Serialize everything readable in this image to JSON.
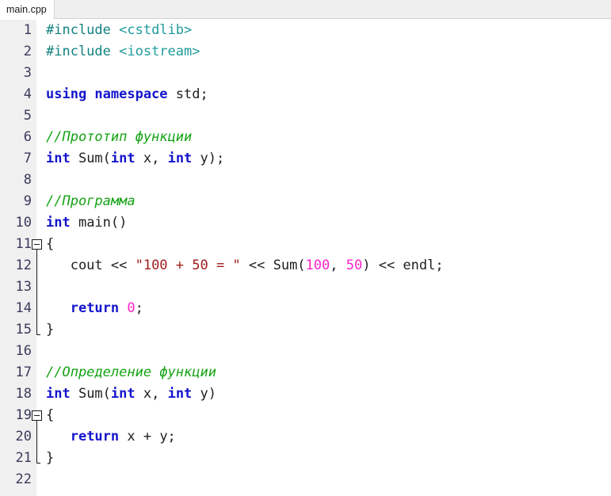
{
  "window": {
    "title": "main.cpp",
    "gutter_bg": "#f0f0f0",
    "editor_bg": "#ffffff",
    "tabbar_bg": "#efefef"
  },
  "tabs": [
    {
      "label": "main.cpp",
      "active": true
    }
  ],
  "colors": {
    "preprocessor": "#12817f",
    "header": "#1f9c9c",
    "keyword": "#1414cc",
    "comment": "#13a313",
    "string": "#9e1c1c",
    "number": "#ff22cc",
    "plain": "#202020",
    "linenumber": "#3a3a5c"
  },
  "editor": {
    "language": "C++",
    "total_lines": 22,
    "lines": [
      {
        "n": "1",
        "fold": "none",
        "tokens": [
          {
            "t": "pre",
            "v": "#include "
          },
          {
            "t": "hdr",
            "v": "<cstdlib>"
          }
        ]
      },
      {
        "n": "2",
        "fold": "none",
        "tokens": [
          {
            "t": "pre",
            "v": "#include "
          },
          {
            "t": "hdr",
            "v": "<iostream>"
          }
        ]
      },
      {
        "n": "3",
        "fold": "none",
        "tokens": []
      },
      {
        "n": "4",
        "fold": "none",
        "tokens": [
          {
            "t": "kw",
            "v": "using namespace"
          },
          {
            "t": "plain",
            "v": " std;"
          }
        ]
      },
      {
        "n": "5",
        "fold": "none",
        "tokens": []
      },
      {
        "n": "6",
        "fold": "none",
        "tokens": [
          {
            "t": "cmt",
            "v": "//Прототип функции"
          }
        ]
      },
      {
        "n": "7",
        "fold": "none",
        "tokens": [
          {
            "t": "kw",
            "v": "int"
          },
          {
            "t": "plain",
            "v": " Sum("
          },
          {
            "t": "kw",
            "v": "int"
          },
          {
            "t": "plain",
            "v": " x, "
          },
          {
            "t": "kw",
            "v": "int"
          },
          {
            "t": "plain",
            "v": " y);"
          }
        ]
      },
      {
        "n": "8",
        "fold": "none",
        "tokens": []
      },
      {
        "n": "9",
        "fold": "none",
        "tokens": [
          {
            "t": "cmt",
            "v": "//Программа"
          }
        ]
      },
      {
        "n": "10",
        "fold": "none",
        "tokens": [
          {
            "t": "kw",
            "v": "int"
          },
          {
            "t": "plain",
            "v": " main()"
          }
        ]
      },
      {
        "n": "11",
        "fold": "box",
        "tokens": [
          {
            "t": "brace",
            "v": "{"
          }
        ]
      },
      {
        "n": "12",
        "fold": "line",
        "tokens": [
          {
            "t": "plain",
            "v": "   cout << "
          },
          {
            "t": "str",
            "v": "\"100 + 50 = \""
          },
          {
            "t": "plain",
            "v": " << Sum("
          },
          {
            "t": "num",
            "v": "100"
          },
          {
            "t": "plain",
            "v": ", "
          },
          {
            "t": "num",
            "v": "50"
          },
          {
            "t": "plain",
            "v": ") << endl;"
          }
        ]
      },
      {
        "n": "13",
        "fold": "line",
        "tokens": []
      },
      {
        "n": "14",
        "fold": "line",
        "tokens": [
          {
            "t": "plain",
            "v": "   "
          },
          {
            "t": "kw",
            "v": "return"
          },
          {
            "t": "plain",
            "v": " "
          },
          {
            "t": "num",
            "v": "0"
          },
          {
            "t": "plain",
            "v": ";"
          }
        ]
      },
      {
        "n": "15",
        "fold": "end",
        "tokens": [
          {
            "t": "brace",
            "v": "}"
          }
        ]
      },
      {
        "n": "16",
        "fold": "none",
        "tokens": []
      },
      {
        "n": "17",
        "fold": "none",
        "tokens": [
          {
            "t": "cmt",
            "v": "//Определение функции"
          }
        ]
      },
      {
        "n": "18",
        "fold": "none",
        "tokens": [
          {
            "t": "kw",
            "v": "int"
          },
          {
            "t": "plain",
            "v": " Sum("
          },
          {
            "t": "kw",
            "v": "int"
          },
          {
            "t": "plain",
            "v": " x, "
          },
          {
            "t": "kw",
            "v": "int"
          },
          {
            "t": "plain",
            "v": " y)"
          }
        ]
      },
      {
        "n": "19",
        "fold": "box",
        "tokens": [
          {
            "t": "brace",
            "v": "{"
          }
        ]
      },
      {
        "n": "20",
        "fold": "line",
        "tokens": [
          {
            "t": "plain",
            "v": "   "
          },
          {
            "t": "kw",
            "v": "return"
          },
          {
            "t": "plain",
            "v": " x + y;"
          }
        ]
      },
      {
        "n": "21",
        "fold": "end",
        "tokens": [
          {
            "t": "brace",
            "v": "}"
          }
        ]
      },
      {
        "n": "22",
        "fold": "none",
        "tokens": []
      }
    ]
  }
}
